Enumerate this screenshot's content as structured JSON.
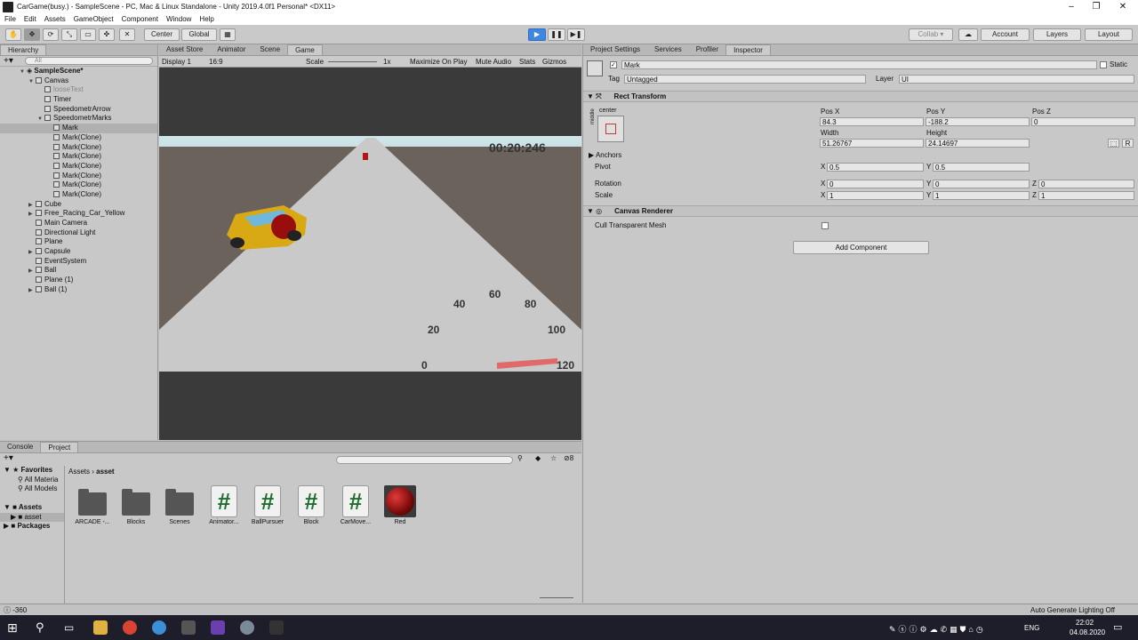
{
  "window": {
    "title": "CarGame(busy.) - SampleScene - PC, Mac & Linux Standalone - Unity 2019.4.0f1 Personal* <DX11>",
    "min": "–",
    "max": "❐",
    "close": "✕"
  },
  "menu": [
    "File",
    "Edit",
    "Assets",
    "GameObject",
    "Component",
    "Window",
    "Help"
  ],
  "toolbar": {
    "center": "Center",
    "global": "Global",
    "collab": "Collab ▾",
    "account": "Account",
    "layers": "Layers",
    "layout": "Layout",
    "play": "▶",
    "pause": "❚❚",
    "step": "▶❚"
  },
  "hierarchy": {
    "tab": "Hierarchy",
    "search": "All",
    "scene": "SampleScene*",
    "rows": [
      {
        "label": "Canvas",
        "depth": 1,
        "arrow": "▼",
        "dim": false,
        "sel": false
      },
      {
        "label": "looseText",
        "depth": 2,
        "arrow": "",
        "dim": true,
        "sel": false
      },
      {
        "label": "Timer",
        "depth": 2,
        "arrow": "",
        "dim": false,
        "sel": false
      },
      {
        "label": "SpeedometrArrow",
        "depth": 2,
        "arrow": "",
        "dim": false,
        "sel": false
      },
      {
        "label": "SpeedometrMarks",
        "depth": 2,
        "arrow": "▼",
        "dim": false,
        "sel": false
      },
      {
        "label": "Mark",
        "depth": 3,
        "arrow": "",
        "dim": false,
        "sel": true
      },
      {
        "label": "Mark(Clone)",
        "depth": 3,
        "arrow": "",
        "dim": false,
        "sel": false
      },
      {
        "label": "Mark(Clone)",
        "depth": 3,
        "arrow": "",
        "dim": false,
        "sel": false
      },
      {
        "label": "Mark(Clone)",
        "depth": 3,
        "arrow": "",
        "dim": false,
        "sel": false
      },
      {
        "label": "Mark(Clone)",
        "depth": 3,
        "arrow": "",
        "dim": false,
        "sel": false
      },
      {
        "label": "Mark(Clone)",
        "depth": 3,
        "arrow": "",
        "dim": false,
        "sel": false
      },
      {
        "label": "Mark(Clone)",
        "depth": 3,
        "arrow": "",
        "dim": false,
        "sel": false
      },
      {
        "label": "Mark(Clone)",
        "depth": 3,
        "arrow": "",
        "dim": false,
        "sel": false
      },
      {
        "label": "Cube",
        "depth": 1,
        "arrow": "▶",
        "dim": false,
        "sel": false
      },
      {
        "label": "Free_Racing_Car_Yellow",
        "depth": 1,
        "arrow": "▶",
        "dim": false,
        "sel": false
      },
      {
        "label": "Main Camera",
        "depth": 1,
        "arrow": "",
        "dim": false,
        "sel": false
      },
      {
        "label": "Directional Light",
        "depth": 1,
        "arrow": "",
        "dim": false,
        "sel": false
      },
      {
        "label": "Plane",
        "depth": 1,
        "arrow": "",
        "dim": false,
        "sel": false
      },
      {
        "label": "Capsule",
        "depth": 1,
        "arrow": "▶",
        "dim": false,
        "sel": false
      },
      {
        "label": "EventSystem",
        "depth": 1,
        "arrow": "",
        "dim": false,
        "sel": false
      },
      {
        "label": "Ball",
        "depth": 1,
        "arrow": "▶",
        "dim": false,
        "sel": false
      },
      {
        "label": "Plane (1)",
        "depth": 1,
        "arrow": "",
        "dim": false,
        "sel": false
      },
      {
        "label": "Ball (1)",
        "depth": 1,
        "arrow": "▶",
        "dim": false,
        "sel": false
      }
    ]
  },
  "viewtabs": [
    "Asset Store",
    "Animator",
    "Scene",
    "Game"
  ],
  "gamebar": {
    "display": "Display 1",
    "aspect": "16:9",
    "scale": "Scale",
    "scale_val": "1x",
    "maximize": "Maximize On Play",
    "mute": "Mute Audio",
    "stats": "Stats",
    "gizmos": "Gizmos"
  },
  "game": {
    "timer": "00:20:246",
    "marks": [
      "0",
      "20",
      "40",
      "60",
      "80",
      "100",
      "120"
    ]
  },
  "inspector": {
    "tabs": [
      "Project Settings",
      "Services",
      "Profiler",
      "Inspector"
    ],
    "name": "Mark",
    "static": "Static",
    "tag_label": "Tag",
    "tag": "Untagged",
    "layer_label": "Layer",
    "layer": "UI",
    "rect_title": "Rect Transform",
    "anchor_top": "center",
    "anchor_side": "middle",
    "posx_label": "Pos X",
    "posy_label": "Pos Y",
    "posz_label": "Pos Z",
    "posx": "84.3",
    "posy": "-188.2",
    "posz": "0",
    "width_label": "Width",
    "height_label": "Height",
    "width": "51.26767",
    "height": "24.14697",
    "r_btn": "R",
    "anchors": "Anchors",
    "pivot": "Pivot",
    "pivot_x": "0.5",
    "pivot_y": "0.5",
    "rotation": "Rotation",
    "rot_x": "0",
    "rot_y": "0",
    "rot_z": "0",
    "scale": "Scale",
    "scale_x": "1",
    "scale_y": "1",
    "scale_z": "1",
    "axis_x": "X",
    "axis_y": "Y",
    "axis_z": "Z",
    "canvas_title": "Canvas Renderer",
    "cull": "Cull Transparent Mesh",
    "add_component": "Add Component"
  },
  "project": {
    "tabs": [
      "Console",
      "Project"
    ],
    "favorites": "Favorites",
    "fav_items": [
      "All Materia",
      "All Models"
    ],
    "assets": "Assets",
    "asset": "asset",
    "packages": "Packages",
    "crumb_root": "Assets",
    "crumb_leaf": "asset",
    "count": "8",
    "items": [
      {
        "name": "ARCADE -...",
        "kind": "folder"
      },
      {
        "name": "Blocks",
        "kind": "folder"
      },
      {
        "name": "Scenes",
        "kind": "folder"
      },
      {
        "name": "Animator...",
        "kind": "script"
      },
      {
        "name": "BallPursuer",
        "kind": "script"
      },
      {
        "name": "Block",
        "kind": "script"
      },
      {
        "name": "CarMove...",
        "kind": "script"
      },
      {
        "name": "Red",
        "kind": "material"
      }
    ]
  },
  "status": {
    "left": "-360",
    "right": "Auto Generate Lighting Off"
  },
  "taskbar": {
    "lang": "ENG",
    "time": "22:02",
    "date": "04.08.2020"
  }
}
